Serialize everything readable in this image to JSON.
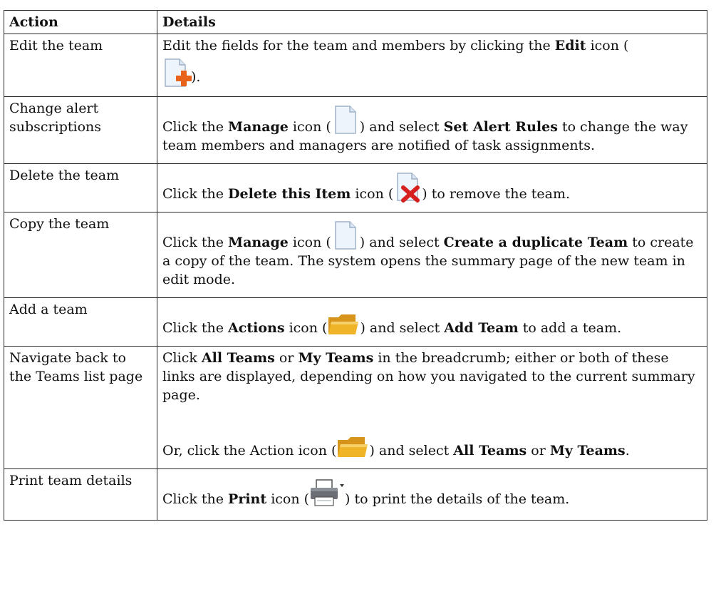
{
  "table": {
    "headers": [
      "Action",
      "Details"
    ],
    "rows": [
      {
        "action": "Edit the team",
        "parts": [
          "Edit the fields for the team and members by clicking the ",
          "Edit",
          " icon (",
          ")."
        ],
        "icons": [
          "edit-doc-plus"
        ]
      },
      {
        "action": "Change alert subscriptions",
        "parts": [
          "Click the ",
          "Manage",
          " icon (",
          ") and select ",
          "Set Alert Rules",
          " to change the way team members and managers are notified of task assignments."
        ],
        "icons": [
          "manage-doc"
        ]
      },
      {
        "action": "Delete the team",
        "parts": [
          "Click the ",
          "Delete this Item",
          " icon (",
          ") to remove the team."
        ],
        "icons": [
          "delete-doc-x"
        ]
      },
      {
        "action": "Copy the team",
        "parts": [
          "Click the ",
          "Manage",
          " icon (",
          ") and select ",
          "Create a duplicate Team",
          " to create a copy of the team. The system opens the summary page of the new team in edit mode."
        ],
        "icons": [
          "manage-doc"
        ]
      },
      {
        "action": "Add a team",
        "parts": [
          "Click the ",
          "Actions",
          " icon (",
          ") and select ",
          "Add Team",
          " to add a team."
        ],
        "icons": [
          "folder"
        ]
      },
      {
        "action": "Navigate back to the Teams list page",
        "parts": [
          "Click ",
          "All Teams",
          " or ",
          "My Teams",
          " in the breadcrumb; either or both of these links are displayed, depending on how you navigated to the current summary page."
        ],
        "parts2": [
          "Or, click the Action icon (",
          ") and select ",
          "All Teams",
          " or ",
          "My Teams",
          "."
        ],
        "icons": [
          "folder"
        ]
      },
      {
        "action": "Print team details",
        "parts": [
          "Click the ",
          "Print",
          " icon (",
          ") to print the details of the team."
        ],
        "icons": [
          "printer"
        ]
      }
    ]
  },
  "colors": {
    "border": "#2a2a2a",
    "doc_fill": "#eef4fb",
    "doc_stroke": "#9fb2c8",
    "plus": "#e8621a",
    "x": "#d62020",
    "folder": "#f0b429"
  }
}
